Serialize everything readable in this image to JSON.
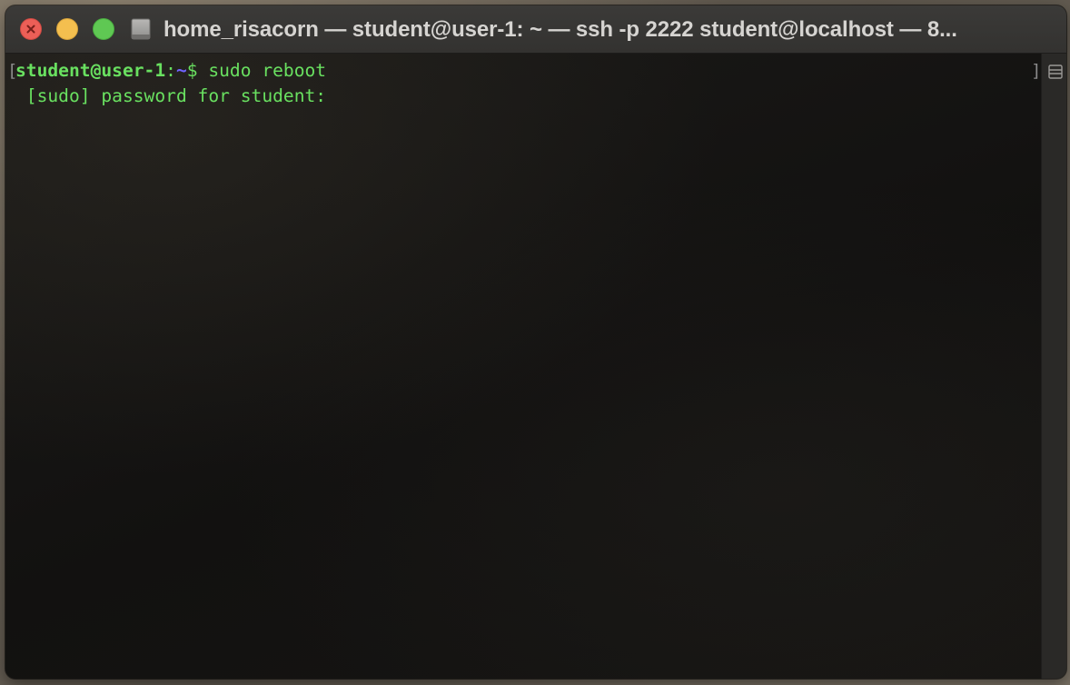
{
  "window": {
    "title": "home_risacorn — student@user-1: ~ — ssh -p 2222 student@localhost — 8..."
  },
  "titlebar": {
    "icons": {
      "close": "close-icon",
      "minimize": "minimize-icon",
      "zoom": "zoom-icon",
      "disk": "disk-icon"
    },
    "colors": {
      "close": "#ec5f57",
      "minimize": "#f4bf4f",
      "zoom": "#5fc853"
    }
  },
  "terminal": {
    "bracket_left": "[",
    "bracket_right": "]",
    "prompt": {
      "user_host": "student@user-1",
      "colon": ":",
      "path": "~",
      "symbol": "$",
      "command": " sudo reboot"
    },
    "output": " [sudo] password for student:",
    "colors": {
      "text": "#69e060",
      "path": "#6f63ff",
      "background": "#151412"
    }
  },
  "scrollbar": {
    "icon": "split-pane-icon"
  }
}
